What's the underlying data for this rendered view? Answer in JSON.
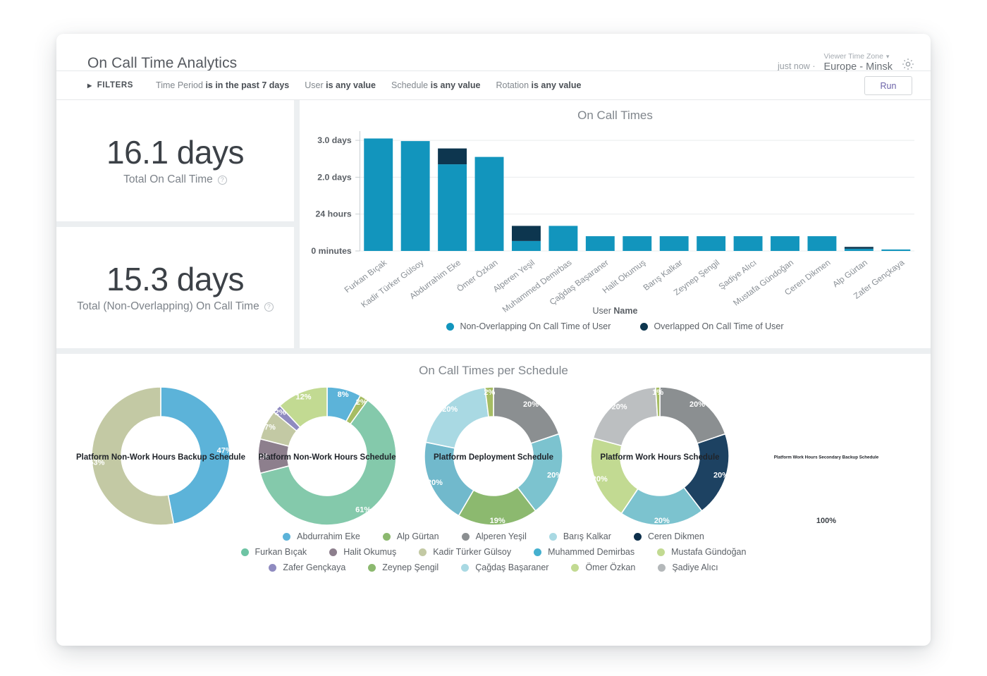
{
  "header": {
    "title": "On Call Time Analytics",
    "just_now": "just now",
    "separator": "·",
    "timezone_label": "Viewer Time Zone",
    "timezone_value": "Europe - Minsk",
    "gear_icon": "gear-icon",
    "caret_icon": "chevron-down-icon"
  },
  "filterbar": {
    "toggle_label": "FILTERS",
    "toggle_icon": "triangle-right-icon",
    "run_label": "Run",
    "filters": [
      {
        "name": "Time Period",
        "value": "is in the past 7 days"
      },
      {
        "name": "User",
        "value": "is any value"
      },
      {
        "name": "Schedule",
        "value": "is any value"
      },
      {
        "name": "Rotation",
        "value": "is any value"
      }
    ]
  },
  "kpis": [
    {
      "value": "16.1 days",
      "label": "Total On Call Time",
      "info_icon": "question-circle-icon"
    },
    {
      "value": "15.3 days",
      "label": "Total (Non-Overlapping) On Call Time",
      "info_icon": "question-circle-icon"
    }
  ],
  "schedule_panel": {
    "title": "On Call Times per Schedule"
  },
  "chart_data": [
    {
      "type": "bar",
      "title": "On Call Times",
      "xlabel_prefix": "User ",
      "xlabel_bold": "Name",
      "ylabel": "",
      "stacked": true,
      "grid": true,
      "legend_position": "bottom",
      "ytick_labels": [
        "0 minutes",
        "24 hours",
        "2.0 days",
        "3.0 days"
      ],
      "ytick_values": [
        0,
        1,
        2,
        3
      ],
      "ylim": [
        0,
        3.25
      ],
      "yunit": "days",
      "categories": [
        "Furkan Bıçak",
        "Kadir Türker Gülsoy",
        "Abdurrahim Eke",
        "Ömer Özkan",
        "Alperen Yeşil",
        "Muhammed Demirbas",
        "Çağdaş Başaraner",
        "Halit Okumuş",
        "Barış Kalkar",
        "Zeynep Şengil",
        "Şadiye Alıcı",
        "Mustafa Gündoğan",
        "Ceren Dikmen",
        "Alp Gürtan",
        "Zafer Gençkaya"
      ],
      "series": [
        {
          "name": "Non-Overlapping On Call Time of User",
          "color": "#1295bd",
          "values": [
            3.05,
            2.98,
            2.35,
            2.55,
            0.27,
            0.68,
            0.4,
            0.4,
            0.4,
            0.4,
            0.4,
            0.4,
            0.4,
            0.06,
            0.04
          ]
        },
        {
          "name": "Overlapped On Call Time of User",
          "color": "#0d364f",
          "values": [
            0,
            0,
            0.43,
            0,
            0.41,
            0,
            0,
            0,
            0,
            0,
            0,
            0,
            0,
            0.05,
            0
          ]
        }
      ]
    },
    {
      "type": "pie",
      "title": "Platform Non-Work Hours Backup Schedule",
      "title_size": "normal",
      "labels": [
        "Muhammed Demirbas",
        "Kadir Türker Gülsoy"
      ],
      "values": [
        47,
        53
      ],
      "display_labels": [
        "47%",
        "53%"
      ],
      "colors": [
        "#5cb3d9",
        "#c3c9a4"
      ],
      "label_colors": [
        "#ffffff",
        "#ffffff"
      ]
    },
    {
      "type": "pie",
      "title": "Platform Non-Work Hours Schedule",
      "title_size": "normal",
      "labels": [
        "Muhammed Demirbas",
        "Zeynep Şengil",
        "Furkan Bıçak",
        "Halit Okumuş",
        "Kadir Türker Gülsoy",
        "Zafer Gençkaya",
        "Ömer Özkan"
      ],
      "values": [
        8,
        2,
        61,
        8,
        7,
        2,
        12
      ],
      "display_labels": [
        "8%",
        "2%",
        "61%",
        "8%",
        "7%",
        "2%",
        "12%"
      ],
      "colors": [
        "#5cb3d9",
        "#a6bd63",
        "#84c9ab",
        "#8d7f8d",
        "#c3c9a4",
        "#8f8bc0",
        "#c2da92"
      ],
      "label_colors": [
        "#ffffff",
        "#ffffff",
        "#ffffff",
        "#ffffff",
        "#ffffff",
        "#ffffff",
        "#ffffff"
      ]
    },
    {
      "type": "pie",
      "title": "Platform Deployment Schedule",
      "title_size": "normal",
      "labels": [
        "Şadiye Alıcı",
        "Barış Kalkar",
        "Alp Gürtan",
        "Çağdaş Başaraner",
        "Alperen Yeşil",
        "Zeynep Şengil"
      ],
      "values": [
        20,
        20,
        19,
        20,
        20,
        2
      ],
      "display_labels": [
        "20%",
        "20%",
        "19%",
        "20%",
        "20%",
        "2%"
      ],
      "colors": [
        "#8b8f91",
        "#7cc3cf",
        "#8cb96f",
        "#71b9cc",
        "#a9d9e3",
        "#a6bd63"
      ],
      "label_colors": [
        "#ffffff",
        "#ffffff",
        "#ffffff",
        "#ffffff",
        "#ffffff",
        "#ffffff"
      ]
    },
    {
      "type": "pie",
      "title": "Platform Work Hours Schedule",
      "title_size": "normal",
      "labels": [
        "Şadiye Alıcı",
        "Ceren Dikmen",
        "Barış Kalkar",
        "Mustafa Gündoğan",
        "Alperen Yeşil",
        "Zeynep Şengil"
      ],
      "values": [
        20,
        20,
        20,
        20,
        20,
        1
      ],
      "display_labels": [
        "20%",
        "20%",
        "20%",
        "20%",
        "20%",
        "1%"
      ],
      "colors": [
        "#8b8f91",
        "#1d4262",
        "#7cc3cf",
        "#c2da92",
        "#bcbfc1",
        "#a6bd63"
      ],
      "label_colors": [
        "#ffffff",
        "#ffffff",
        "#ffffff",
        "#ffffff",
        "#ffffff",
        "#ffffff"
      ]
    },
    {
      "type": "pie",
      "title": "Platform Work Hours Secondary Backup Schedule",
      "title_size": "small",
      "labels": [
        "Ömer Özkan"
      ],
      "values": [
        100
      ],
      "display_labels": [
        "100%"
      ],
      "colors": [
        "#c2da92"
      ],
      "label_colors": [
        "#3c4147"
      ]
    }
  ],
  "donut_legend": [
    {
      "label": "Abdurrahim Eke",
      "color": "#5cb3d9"
    },
    {
      "label": "Alp Gürtan",
      "color": "#8cb96f"
    },
    {
      "label": "Alperen Yeşil",
      "color": "#8b8f91"
    },
    {
      "label": "Barış Kalkar",
      "color": "#a9d9e3"
    },
    {
      "label": "Ceren Dikmen",
      "color": "#0d2f4b"
    },
    {
      "label": "Furkan Bıçak",
      "color": "#6ec4a4"
    },
    {
      "label": "Halit Okumuş",
      "color": "#8d7f8d"
    },
    {
      "label": "Kadir Türker Gülsoy",
      "color": "#c3c9a4"
    },
    {
      "label": "Muhammed Demirbas",
      "color": "#45b0cf"
    },
    {
      "label": "Mustafa Gündoğan",
      "color": "#c2da92"
    },
    {
      "label": "Zafer Gençkaya",
      "color": "#8f8bc0"
    },
    {
      "label": "Zeynep Şengil",
      "color": "#8cb96f"
    },
    {
      "label": "Çağdaş Başaraner",
      "color": "#a9d9e3"
    },
    {
      "label": "Ömer Özkan",
      "color": "#c2da92"
    },
    {
      "label": "Şadiye Alıcı",
      "color": "#b4b8ba"
    }
  ],
  "donut_legend_rows": [
    5,
    10
  ],
  "colors": {
    "accent_blue": "#1295bd",
    "dark_navy": "#0d364f",
    "panel_gap": "#eceff1",
    "run_text": "#6b62a8"
  }
}
